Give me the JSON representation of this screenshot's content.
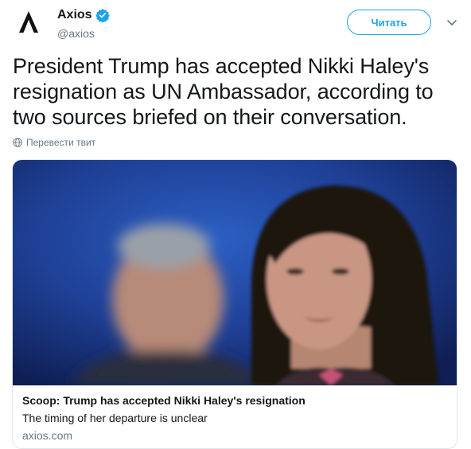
{
  "author": {
    "display_name": "Axios",
    "handle": "@axios",
    "verified": true,
    "avatar_icon": "axios-logo-icon"
  },
  "follow_button": {
    "label": "Читать"
  },
  "menu": {
    "icon": "chevron-down-icon"
  },
  "tweet": {
    "text": "President Trump has accepted Nikki Haley's resignation as UN Ambassador, according to two sources briefed on their conversation."
  },
  "translate": {
    "label": "Перевести твит",
    "icon": "globe-icon"
  },
  "card": {
    "title": "Scoop: Trump has accepted Nikki Haley's resignation",
    "description": "The timing of her departure is unclear",
    "domain": "axios.com"
  },
  "colors": {
    "accent": "#1da1f2",
    "text": "#14171a",
    "secondary": "#657786",
    "border": "#e1e8ed"
  }
}
